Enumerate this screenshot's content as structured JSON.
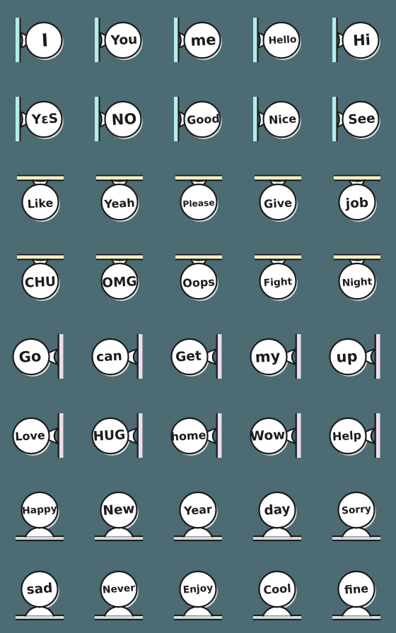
{
  "sheet": {
    "title": "Speech Bubble Word Stickers",
    "background_color": "#4c6b72",
    "columns": 5,
    "rows": 8,
    "cell_size_px": 112,
    "bubble_fill": "#ffffff",
    "bubble_stroke": "#1b1b1b",
    "shadow_color": "#d8dcdc"
  },
  "styles": {
    "left_bar": {
      "name": "cyan-left-bar",
      "bar_color": "#b6ece9",
      "bar_edge_color": "#1b1b1b",
      "bar_orientation": "vertical",
      "bar_side": "left"
    },
    "top_bar": {
      "name": "cream-top-bar",
      "bar_color": "#f2efc4",
      "bar_edge_color": "#1b1b1b",
      "bar_orientation": "horizontal",
      "bar_side": "top"
    },
    "right_bar": {
      "name": "pink-right-bar",
      "bar_color": "#eddcea",
      "bar_edge_color": "#1b1b1b",
      "bar_orientation": "vertical",
      "bar_side": "right"
    },
    "bottom_bar": {
      "name": "gray-bottom-bar",
      "bar_color": "#d3d7d8",
      "bar_edge_color": "#1b1b1b",
      "bar_orientation": "horizontal",
      "bar_side": "bottom"
    }
  },
  "stickers": [
    {
      "label": "I",
      "style": "left_bar",
      "row": 1,
      "col": 1
    },
    {
      "label": "You",
      "style": "left_bar",
      "row": 1,
      "col": 2
    },
    {
      "label": "me",
      "style": "left_bar",
      "row": 1,
      "col": 3
    },
    {
      "label": "Hello",
      "style": "left_bar",
      "row": 1,
      "col": 4
    },
    {
      "label": "Hi",
      "style": "left_bar",
      "row": 1,
      "col": 5
    },
    {
      "label": "YɛS",
      "style": "left_bar",
      "row": 2,
      "col": 1
    },
    {
      "label": "NO",
      "style": "left_bar",
      "row": 2,
      "col": 2
    },
    {
      "label": "Good",
      "style": "left_bar",
      "row": 2,
      "col": 3
    },
    {
      "label": "Nice",
      "style": "left_bar",
      "row": 2,
      "col": 4
    },
    {
      "label": "See",
      "style": "left_bar",
      "row": 2,
      "col": 5
    },
    {
      "label": "Like",
      "style": "top_bar",
      "row": 3,
      "col": 1
    },
    {
      "label": "Yeah",
      "style": "top_bar",
      "row": 3,
      "col": 2
    },
    {
      "label": "Please",
      "style": "top_bar",
      "row": 3,
      "col": 3
    },
    {
      "label": "Give",
      "style": "top_bar",
      "row": 3,
      "col": 4
    },
    {
      "label": "job",
      "style": "top_bar",
      "row": 3,
      "col": 5
    },
    {
      "label": "CHU",
      "style": "top_bar",
      "row": 4,
      "col": 1
    },
    {
      "label": "OMG",
      "style": "top_bar",
      "row": 4,
      "col": 2
    },
    {
      "label": "Oops",
      "style": "top_bar",
      "row": 4,
      "col": 3
    },
    {
      "label": "Fight",
      "style": "top_bar",
      "row": 4,
      "col": 4
    },
    {
      "label": "Night",
      "style": "top_bar",
      "row": 4,
      "col": 5
    },
    {
      "label": "Go",
      "style": "right_bar",
      "row": 5,
      "col": 1
    },
    {
      "label": "can",
      "style": "right_bar",
      "row": 5,
      "col": 2
    },
    {
      "label": "Get",
      "style": "right_bar",
      "row": 5,
      "col": 3
    },
    {
      "label": "my",
      "style": "right_bar",
      "row": 5,
      "col": 4
    },
    {
      "label": "up",
      "style": "right_bar",
      "row": 5,
      "col": 5
    },
    {
      "label": "Love",
      "style": "right_bar",
      "row": 6,
      "col": 1
    },
    {
      "label": "HUG",
      "style": "right_bar",
      "row": 6,
      "col": 2
    },
    {
      "label": "home",
      "style": "right_bar",
      "row": 6,
      "col": 3
    },
    {
      "label": "Wow",
      "style": "right_bar",
      "row": 6,
      "col": 4
    },
    {
      "label": "Help",
      "style": "right_bar",
      "row": 6,
      "col": 5
    },
    {
      "label": "Happy",
      "style": "bottom_bar",
      "row": 7,
      "col": 1
    },
    {
      "label": "New",
      "style": "bottom_bar",
      "row": 7,
      "col": 2
    },
    {
      "label": "Year",
      "style": "bottom_bar",
      "row": 7,
      "col": 3
    },
    {
      "label": "day",
      "style": "bottom_bar",
      "row": 7,
      "col": 4
    },
    {
      "label": "Sorry",
      "style": "bottom_bar",
      "row": 7,
      "col": 5
    },
    {
      "label": "sad",
      "style": "bottom_bar",
      "row": 8,
      "col": 1
    },
    {
      "label": "Never",
      "style": "bottom_bar",
      "row": 8,
      "col": 2
    },
    {
      "label": "Enjoy",
      "style": "bottom_bar",
      "row": 8,
      "col": 3
    },
    {
      "label": "Cool",
      "style": "bottom_bar",
      "row": 8,
      "col": 4
    },
    {
      "label": "fine",
      "style": "bottom_bar",
      "row": 8,
      "col": 5
    }
  ]
}
